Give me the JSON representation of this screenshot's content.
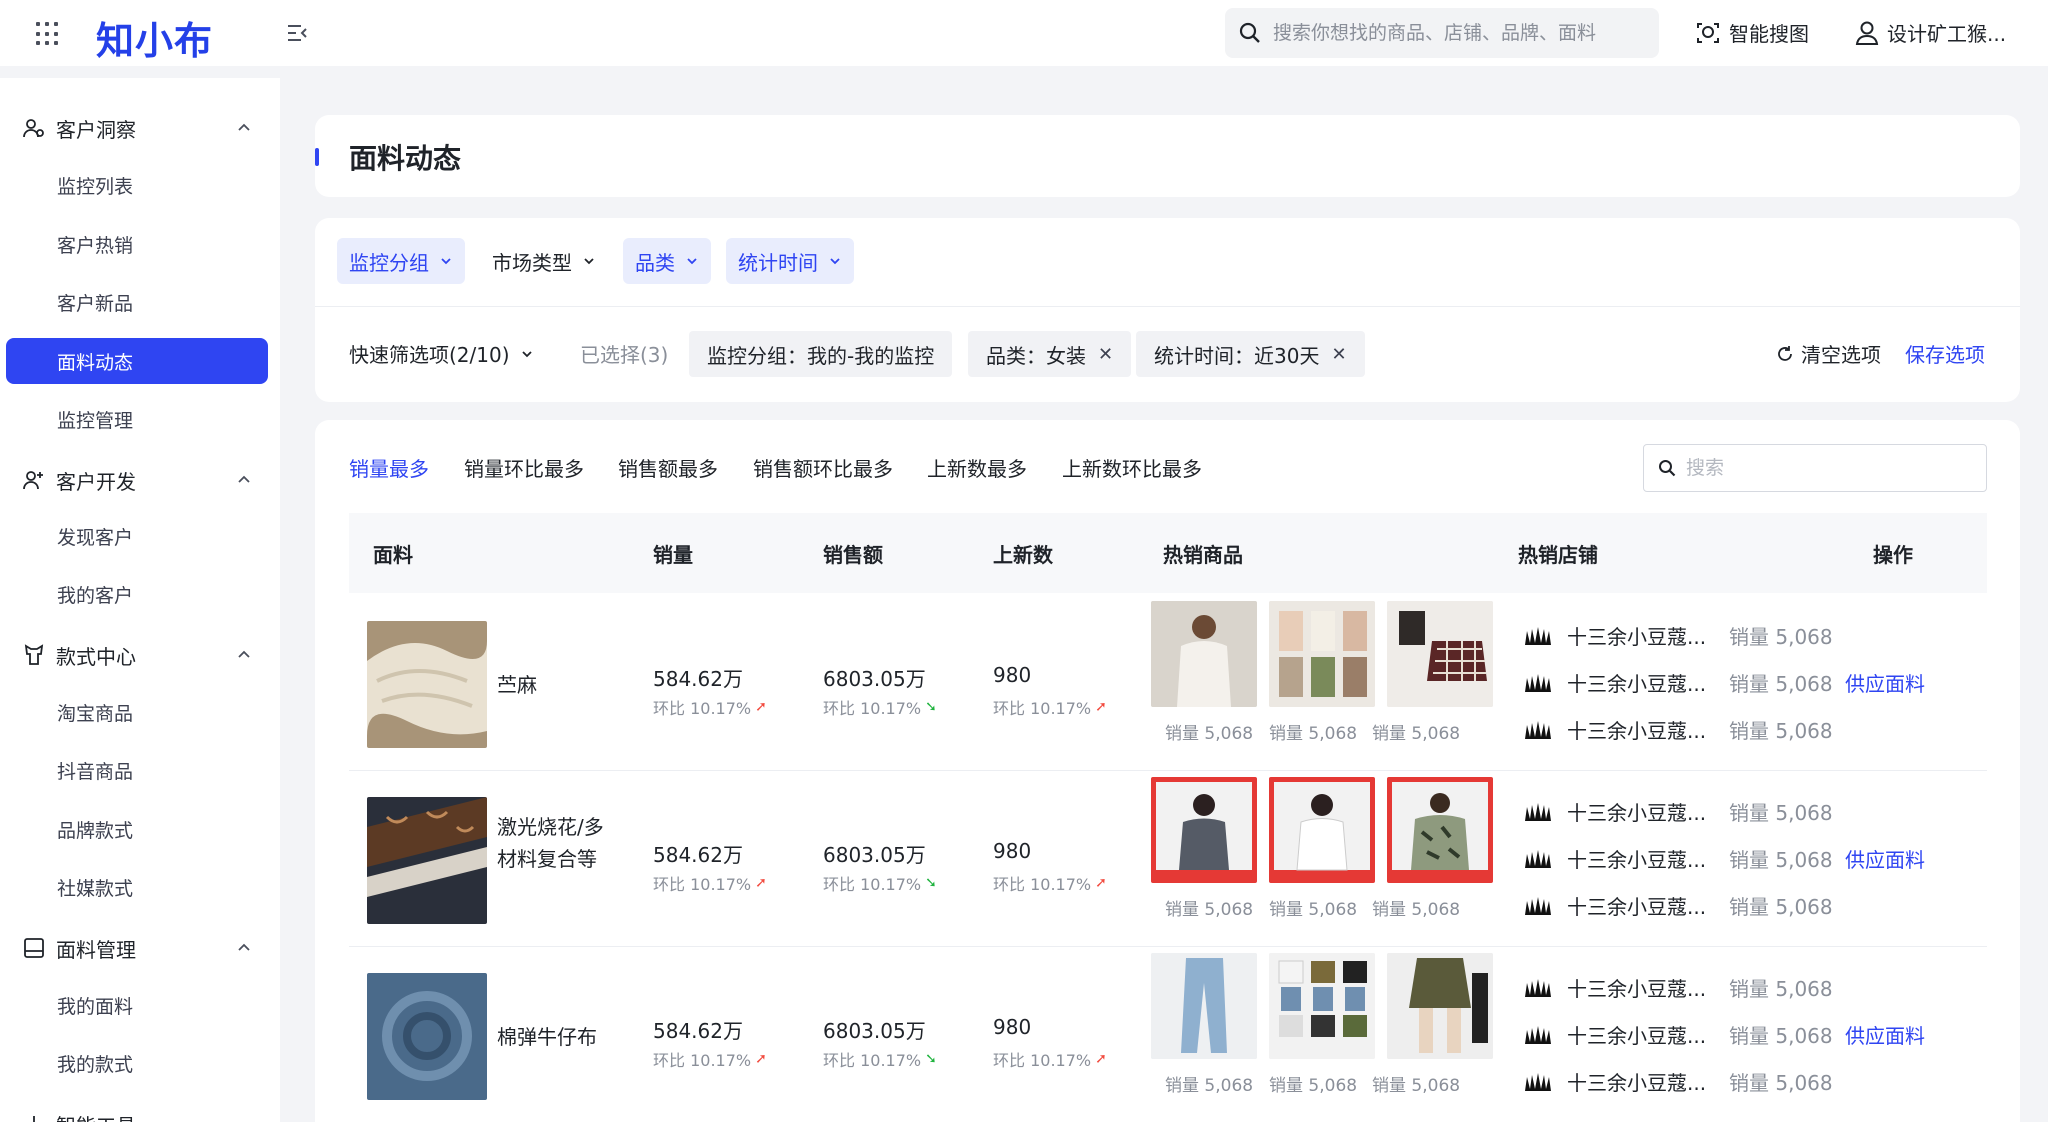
{
  "app": {
    "logo": "知小布"
  },
  "topbar": {
    "search_placeholder": "搜索你想找的商品、店铺、品牌、面料",
    "image_search": "智能搜图",
    "user": "设计矿工猴..."
  },
  "sidebar": {
    "groups": [
      {
        "label": "客户洞察",
        "items": [
          "监控列表",
          "客户热销",
          "客户新品",
          "面料动态",
          "监控管理"
        ]
      },
      {
        "label": "客户开发",
        "items": [
          "发现客户",
          "我的客户"
        ]
      },
      {
        "label": "款式中心",
        "items": [
          "淘宝商品",
          "抖音商品",
          "品牌款式",
          "社媒款式"
        ]
      },
      {
        "label": "面料管理",
        "items": [
          "我的面料",
          "我的款式"
        ]
      },
      {
        "label": "智能工具",
        "items": []
      }
    ],
    "active_item": "面料动态"
  },
  "page": {
    "title": "面料动态"
  },
  "filters": {
    "dropdowns": [
      "监控分组",
      "市场类型",
      "品类",
      "统计时间"
    ],
    "quick_label": "快速筛选项(2/10)",
    "selected_count": "已选择(3)",
    "tags": [
      "监控分组：我的-我的监控",
      "品类：女装",
      "统计时间：近30天"
    ],
    "clear": "清空选项",
    "save": "保存选项"
  },
  "table": {
    "sort_tabs": [
      "销量最多",
      "销量环比最多",
      "销售额最多",
      "销售额环比最多",
      "上新数最多",
      "上新数环比最多"
    ],
    "active_tab": "销量最多",
    "search_placeholder": "搜索",
    "columns": [
      "面料",
      "销量",
      "销售额",
      "上新数",
      "热销商品",
      "热销店铺",
      "操作"
    ],
    "rows": [
      {
        "fabric": "苎麻",
        "sales": "584.62万",
        "sales_change": "环比 10.17%",
        "revenue": "6803.05万",
        "revenue_change": "环比 10.17%",
        "new_count": "980",
        "new_change": "环比 10.17%",
        "products": [
          "销量 5,068",
          "销量 5,068",
          "销量 5,068"
        ],
        "shops": [
          {
            "name": "十三余小豆蔻...",
            "sales": "销量 5,068"
          },
          {
            "name": "十三余小豆蔻...",
            "sales": "销量 5,068"
          },
          {
            "name": "十三余小豆蔻...",
            "sales": "销量 5,068"
          }
        ],
        "action": "供应面料"
      },
      {
        "fabric": "激光烧花/多材料复合等",
        "sales": "584.62万",
        "sales_change": "环比 10.17%",
        "revenue": "6803.05万",
        "revenue_change": "环比 10.17%",
        "new_count": "980",
        "new_change": "环比 10.17%",
        "products": [
          "销量 5,068",
          "销量 5,068",
          "销量 5,068"
        ],
        "shops": [
          {
            "name": "十三余小豆蔻...",
            "sales": "销量 5,068"
          },
          {
            "name": "十三余小豆蔻...",
            "sales": "销量 5,068"
          },
          {
            "name": "十三余小豆蔻...",
            "sales": "销量 5,068"
          }
        ],
        "action": "供应面料"
      },
      {
        "fabric": "棉弹牛仔布",
        "sales": "584.62万",
        "sales_change": "环比 10.17%",
        "revenue": "6803.05万",
        "revenue_change": "环比 10.17%",
        "new_count": "980",
        "new_change": "环比 10.17%",
        "products": [
          "销量 5,068",
          "销量 5,068",
          "销量 5,068"
        ],
        "shops": [
          {
            "name": "十三余小豆蔻...",
            "sales": "销量 5,068"
          },
          {
            "name": "十三余小豆蔻...",
            "sales": "销量 5,068"
          },
          {
            "name": "十三余小豆蔻...",
            "sales": "销量 5,068"
          }
        ],
        "action": "供应面料"
      }
    ]
  },
  "colors": {
    "accent": "#2f45f2",
    "up": "#f24b3f",
    "down": "#1fb33e"
  }
}
